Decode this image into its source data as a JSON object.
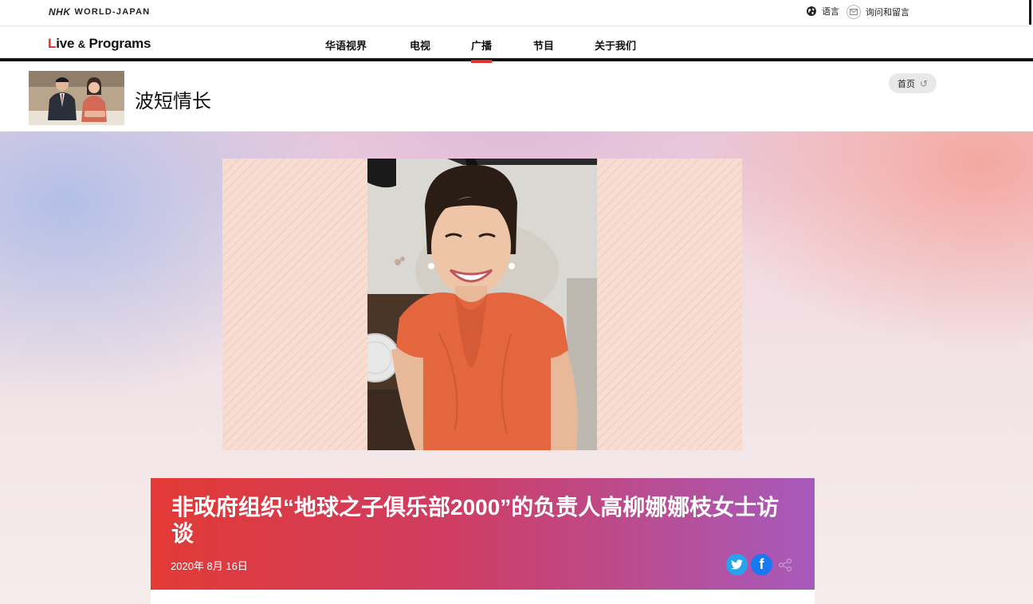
{
  "topbar": {
    "brand_nhk": "NHK",
    "brand_world": "WORLD-JAPAN",
    "language_label": "语言",
    "contact_label": "询问和留言"
  },
  "nav": {
    "logo_l": "L",
    "logo_ive": "ive",
    "logo_amp": "&",
    "logo_programs": "Programs",
    "items": [
      {
        "label": "华语视界",
        "active": false
      },
      {
        "label": "电视",
        "active": false
      },
      {
        "label": "广播",
        "active": true
      },
      {
        "label": "节目",
        "active": false
      },
      {
        "label": "关于我们",
        "active": false
      }
    ],
    "accent_color": "#e8302d"
  },
  "program": {
    "title": "波短情长",
    "home_label": "首页",
    "home_icon": "return-icon"
  },
  "article": {
    "title": "非政府组织“地球之子俱乐部2000”的负责人高柳娜娜枝女士访谈",
    "date": "2020年 8月 16日",
    "share_icons": [
      "twitter-icon",
      "facebook-icon",
      "share-icon"
    ]
  }
}
